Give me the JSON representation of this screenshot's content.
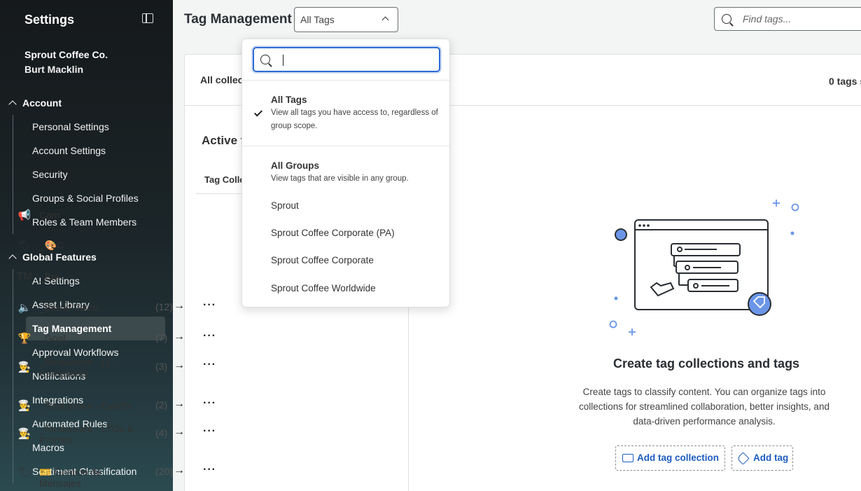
{
  "sidebar": {
    "title": "Settings",
    "org": "Sprout Coffee Co.",
    "user": "Burt Macklin",
    "account": {
      "label": "Account",
      "items": [
        "Personal Settings",
        "Account Settings",
        "Security",
        "Groups & Social Profiles",
        "Roles & Team Members"
      ]
    },
    "global": {
      "label": "Global Features",
      "items": [
        "AI Settings",
        "Asset Library",
        "Tag Management",
        "Approval Workflows",
        "Notifications",
        "Integrations",
        "Automated Rules",
        "Macros",
        "Sentiment Classification"
      ]
    }
  },
  "header": {
    "title": "Tag Management",
    "scope_value": "All Tags",
    "find_placeholder": "Find tags..."
  },
  "card": {
    "all_collections": "All collec",
    "tags_count": "0 tags s",
    "active_heading": "Active t",
    "column_header": "Tag Colle"
  },
  "collections": [
    {
      "icon": "megaphone-icon",
      "name": "Cam",
      "count": "",
      "glyph": "📢"
    },
    {
      "icon": "tag-icon",
      "name": "_🎨C",
      "count": "",
      "glyph": "🏷"
    },
    {
      "icon": "trademark-icon",
      "name": "_Bra",
      "count": "",
      "glyph": "TM"
    },
    {
      "icon": "speaker-icon",
      "name": "_Brand Voice",
      "count": "(12)",
      "glyph": "🔈"
    },
    {
      "icon": "trophy-icon",
      "name": "_Goal",
      "count": "(7)",
      "glyph": "🏆"
    },
    {
      "icon": "chef-icon",
      "name": "_Restaurant - (i) - Complaints",
      "count": "(3)",
      "glyph": "👨‍🍳"
    },
    {
      "icon": "chef-icon",
      "name": "_Restaurant - Events",
      "count": "(2)",
      "glyph": "👨‍🍳"
    },
    {
      "icon": "chef-icon",
      "name": "_Restaurant - LTOs & Promos",
      "count": "(4)",
      "glyph": "👨‍🍳"
    },
    {
      "icon": "tag-icon",
      "name": "🎫 Gestión de Mensajes",
      "count": "(20)",
      "glyph": "🏷"
    }
  ],
  "empty_state": {
    "title": "Create tag collections and tags",
    "description": "Create tags to classify content. You can organize tags into collections for streamlined collaboration, better insights, and data-driven performance analysis.",
    "add_collection": "Add tag collection",
    "add_tag": "Add tag"
  },
  "dropdown": {
    "search_value": "",
    "all_tags_title": "All Tags",
    "all_tags_desc": "View all tags you have access to, regardless of group scope.",
    "all_groups_title": "All Groups",
    "all_groups_desc": "View tags that are visible in any group.",
    "groups": [
      "Sprout",
      "Sprout Coffee Corporate (PA)",
      "Sprout Coffee Corporate",
      "Sprout Coffee Worldwide"
    ]
  },
  "colors": {
    "accent": "#2e6bd6",
    "link": "#1d5cbf",
    "illustration_blue": "#6b96e8"
  }
}
